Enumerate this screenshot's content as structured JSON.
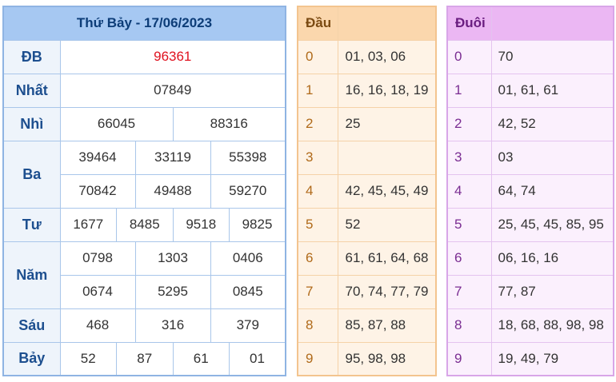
{
  "results": {
    "title": "Thứ Bảy - 17/06/2023",
    "db": {
      "label": "ĐB",
      "values": [
        "96361"
      ]
    },
    "nhat": {
      "label": "Nhất",
      "values": [
        "07849"
      ]
    },
    "nhi": {
      "label": "Nhì",
      "values": [
        "66045",
        "88316"
      ]
    },
    "ba": {
      "label": "Ba",
      "values": [
        "39464",
        "33119",
        "55398",
        "70842",
        "49488",
        "59270"
      ]
    },
    "tu": {
      "label": "Tư",
      "values": [
        "1677",
        "8485",
        "9518",
        "9825"
      ]
    },
    "nam": {
      "label": "Năm",
      "values": [
        "0798",
        "1303",
        "0406",
        "0674",
        "5295",
        "0845"
      ]
    },
    "sau": {
      "label": "Sáu",
      "values": [
        "468",
        "316",
        "379"
      ]
    },
    "bay": {
      "label": "Bảy",
      "values": [
        "52",
        "87",
        "61",
        "01"
      ]
    }
  },
  "heads": {
    "header": "Đầu",
    "rows": [
      {
        "digit": "0",
        "values": "01, 03, 06"
      },
      {
        "digit": "1",
        "values": "16, 16, 18, 19"
      },
      {
        "digit": "2",
        "values": "25"
      },
      {
        "digit": "3",
        "values": ""
      },
      {
        "digit": "4",
        "values": "42, 45, 45, 49"
      },
      {
        "digit": "5",
        "values": "52"
      },
      {
        "digit": "6",
        "values": "61, 61, 64, 68"
      },
      {
        "digit": "7",
        "values": "70, 74, 77, 79"
      },
      {
        "digit": "8",
        "values": "85, 87, 88"
      },
      {
        "digit": "9",
        "values": "95, 98, 98"
      }
    ]
  },
  "tails": {
    "header": "Đuôi",
    "rows": [
      {
        "digit": "0",
        "values": "70"
      },
      {
        "digit": "1",
        "values": "01, 61, 61"
      },
      {
        "digit": "2",
        "values": "42, 52"
      },
      {
        "digit": "3",
        "values": "03"
      },
      {
        "digit": "4",
        "values": "64, 74"
      },
      {
        "digit": "5",
        "values": "25, 45, 45, 85, 95"
      },
      {
        "digit": "6",
        "values": "06, 16, 16"
      },
      {
        "digit": "7",
        "values": "77, 87"
      },
      {
        "digit": "8",
        "values": "18, 68, 88, 98, 98"
      },
      {
        "digit": "9",
        "values": "19, 49, 79"
      }
    ]
  }
}
